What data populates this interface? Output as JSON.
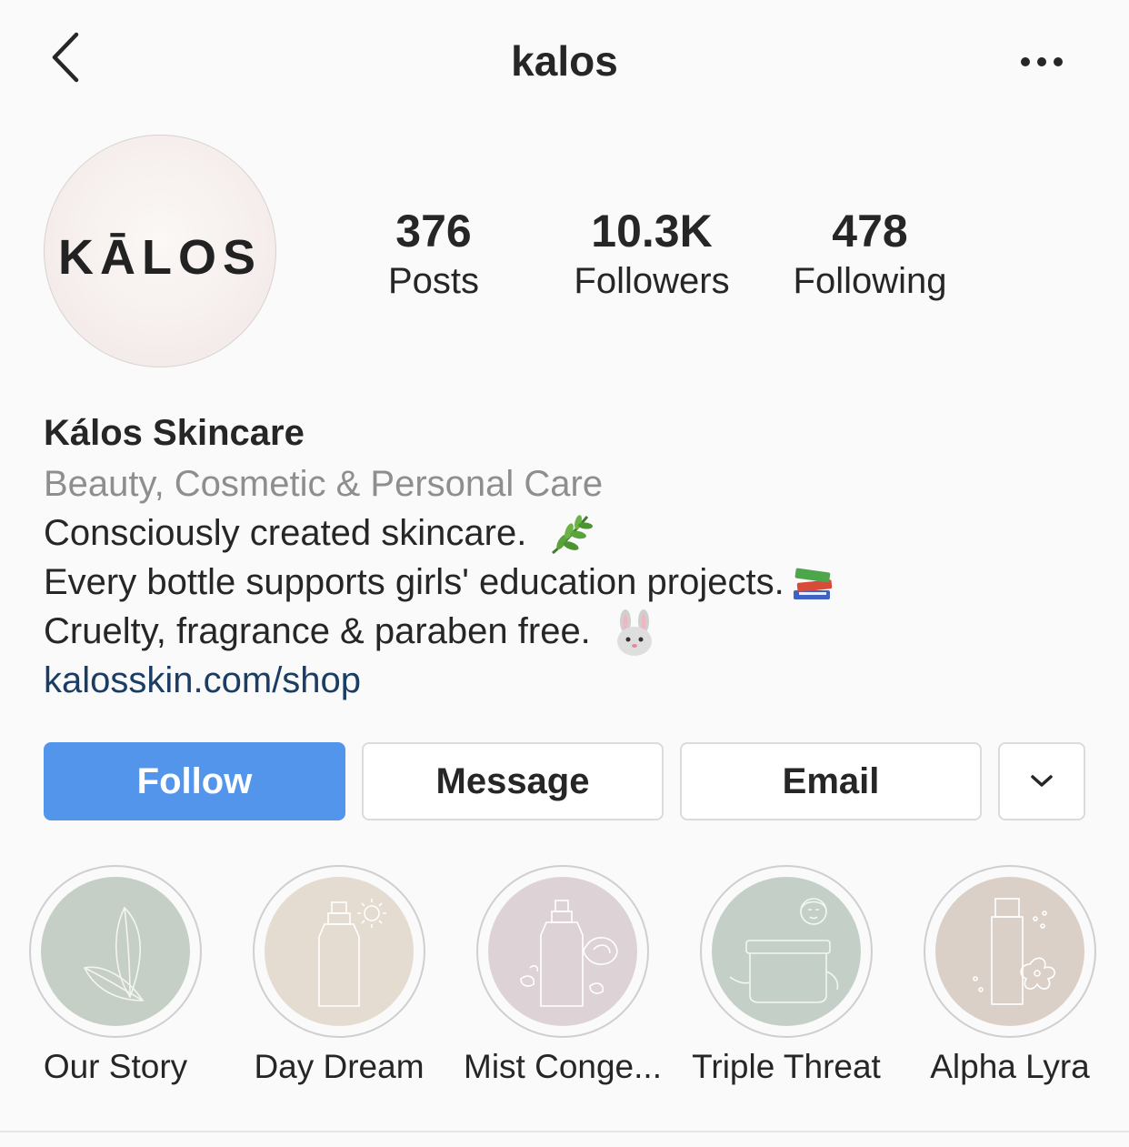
{
  "header": {
    "title": "kalos",
    "back_icon": "chevron-left-icon",
    "more_icon": "ellipsis-horizontal-icon"
  },
  "profile": {
    "avatar_text": "KĀLOS",
    "stats": [
      {
        "value": "376",
        "label": "Posts"
      },
      {
        "value": "10.3K",
        "label": "Followers"
      },
      {
        "value": "478",
        "label": "Following"
      }
    ]
  },
  "bio": {
    "name": "Kálos Skincare",
    "category": "Beauty, Cosmetic & Personal Care",
    "line1": "Consciously created skincare.",
    "line2": "Every bottle supports girls' education projects.",
    "line3": "Cruelty, fragrance & paraben free.",
    "link": "kalosskin.com/shop",
    "emoji1": "herb-icon",
    "emoji2": "books-icon",
    "emoji3": "rabbit-face-icon"
  },
  "actions": {
    "follow": "Follow",
    "message": "Message",
    "email": "Email",
    "more_icon": "chevron-down-icon"
  },
  "highlights": [
    {
      "label": "Our Story",
      "color": "#c5cfc5"
    },
    {
      "label": "Day Dream",
      "color": "#e4dbd1"
    },
    {
      "label": "Mist Conge...",
      "color": "#ddd3d6"
    },
    {
      "label": "Triple Threat",
      "color": "#c4d0c7"
    },
    {
      "label": "Alpha Lyra",
      "color": "#dad0c8"
    }
  ],
  "colors": {
    "accent": "#5295ea",
    "link": "#1c3d63",
    "muted": "#8e8e8e"
  }
}
